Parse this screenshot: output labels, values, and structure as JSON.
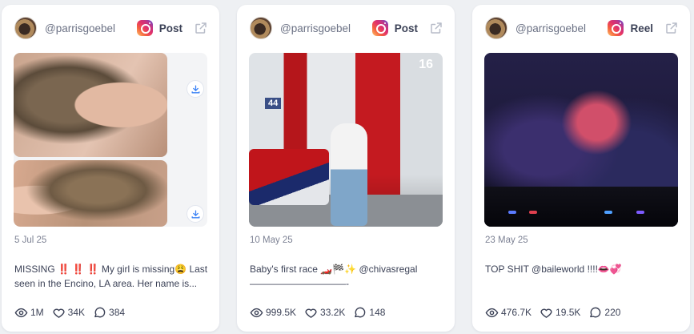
{
  "cards": [
    {
      "handle": "@parrisgoebel",
      "post_type": "Post",
      "date": "5 Jul 25",
      "caption": "MISSING ‼️ ‼️ ‼️ My girl is missing😩 Last seen in the Encino, LA area. Her name is...",
      "views": "1M",
      "likes": "34K",
      "comments": "384"
    },
    {
      "handle": "@parrisgoebel",
      "post_type": "Post",
      "date": "10 May 25",
      "caption": "Baby's first race 🏎️🏁✨ @chivasregal ——————————- #ChivasRegalPartne...",
      "views": "999.5K",
      "likes": "33.2K",
      "comments": "148",
      "image_text": {
        "car_number": "44",
        "badge": "16"
      }
    },
    {
      "handle": "@parrisgoebel",
      "post_type": "Reel",
      "date": "23 May 25",
      "caption": "TOP SHIT @baileworld !!!!👄💞",
      "views": "476.7K",
      "likes": "19.5K",
      "comments": "220"
    }
  ],
  "colors": {
    "background": "#eef0f3",
    "card": "#ffffff",
    "text": "#3c4257",
    "muted": "#7d8294",
    "download_accent": "#3b82f6"
  },
  "icons": [
    "instagram-icon",
    "external-link-icon",
    "download-icon",
    "eye-icon",
    "heart-icon",
    "comment-icon"
  ]
}
